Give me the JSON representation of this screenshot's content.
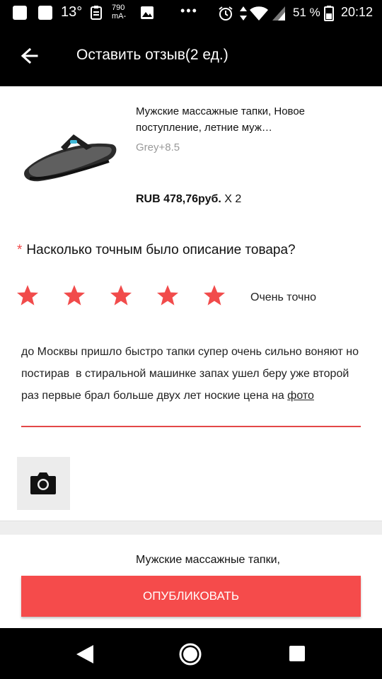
{
  "status_bar": {
    "temperature": "13°",
    "battery_mah_value": "790",
    "battery_mah_unit": "mA-",
    "overflow": "•••",
    "battery_percent": "51 %",
    "time": "20:12"
  },
  "app_bar": {
    "title": "Оставить отзыв(2 ед.)",
    "back_icon": "arrow-left-icon"
  },
  "product": {
    "title": "Мужские массажные тапки, Новое поступление, летние муж…",
    "variant": "Grey+8.5",
    "price": "RUB 478,76руб.",
    "quantity": "X 2",
    "image_icon": "flip-flop-sandal-image"
  },
  "question": {
    "required_mark": "*",
    "text": "Насколько точным было описание товара?"
  },
  "rating": {
    "value": 5,
    "max": 5,
    "label": "Очень точно",
    "star_color": "#f14b4b"
  },
  "review": {
    "text_main": "до Москвы пришло быстро тапки супер очень сильно воняют но постирав  в стиральной машинке запах ушел беру уже второй раз первые брал больше двух лет ноские цена на ",
    "text_underlined": "фото"
  },
  "camera": {
    "icon": "camera-icon"
  },
  "product2": {
    "title": "Мужские массажные тапки,"
  },
  "publish": {
    "label": "ОПУБЛИКОВАТЬ",
    "color": "#f54b4b"
  },
  "nav_bar": {
    "back_icon": "nav-back-icon",
    "home_icon": "nav-home-icon",
    "recent_icon": "nav-recent-icon"
  }
}
